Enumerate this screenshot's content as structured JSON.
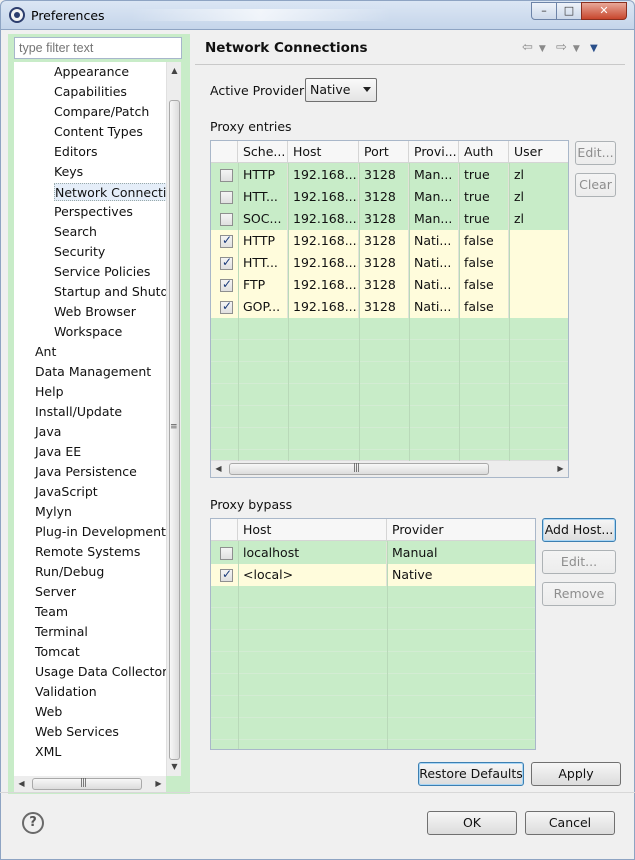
{
  "window": {
    "title": "Preferences"
  },
  "filter": {
    "placeholder": "type filter text"
  },
  "tree": {
    "items": [
      {
        "label": "Appearance",
        "level": 1
      },
      {
        "label": "Capabilities",
        "level": 1
      },
      {
        "label": "Compare/Patch",
        "level": 1
      },
      {
        "label": "Content Types",
        "level": 1
      },
      {
        "label": "Editors",
        "level": 1
      },
      {
        "label": "Keys",
        "level": 1
      },
      {
        "label": "Network Connectio",
        "level": 1,
        "selected": true
      },
      {
        "label": "Perspectives",
        "level": 1
      },
      {
        "label": "Search",
        "level": 1
      },
      {
        "label": "Security",
        "level": 1
      },
      {
        "label": "Service Policies",
        "level": 1
      },
      {
        "label": "Startup and Shutd",
        "level": 1
      },
      {
        "label": "Web Browser",
        "level": 1
      },
      {
        "label": "Workspace",
        "level": 1
      },
      {
        "label": "Ant",
        "level": 0
      },
      {
        "label": "Data Management",
        "level": 0
      },
      {
        "label": "Help",
        "level": 0
      },
      {
        "label": "Install/Update",
        "level": 0
      },
      {
        "label": "Java",
        "level": 0
      },
      {
        "label": "Java EE",
        "level": 0
      },
      {
        "label": "Java Persistence",
        "level": 0
      },
      {
        "label": "JavaScript",
        "level": 0
      },
      {
        "label": "Mylyn",
        "level": 0
      },
      {
        "label": "Plug-in Development",
        "level": 0
      },
      {
        "label": "Remote Systems",
        "level": 0
      },
      {
        "label": "Run/Debug",
        "level": 0
      },
      {
        "label": "Server",
        "level": 0
      },
      {
        "label": "Team",
        "level": 0
      },
      {
        "label": "Terminal",
        "level": 0
      },
      {
        "label": "Tomcat",
        "level": 0
      },
      {
        "label": "Usage Data Collector",
        "level": 0
      },
      {
        "label": "Validation",
        "level": 0
      },
      {
        "label": "Web",
        "level": 0
      },
      {
        "label": "Web Services",
        "level": 0
      },
      {
        "label": "XML",
        "level": 0
      }
    ]
  },
  "page": {
    "title": "Network Connections",
    "active_provider_label": "Active Provider:",
    "active_provider_value": "Native",
    "proxy_entries_label": "Proxy entries",
    "proxy_bypass_label": "Proxy bypass"
  },
  "proxy_entries": {
    "columns": [
      "Sche...",
      "Host",
      "Port",
      "Provi...",
      "Auth",
      "User"
    ],
    "rows": [
      {
        "checked": false,
        "scheme": "HTTP",
        "host": "192.168....",
        "port": "3128",
        "provider": "Man...",
        "auth": "true",
        "user": "zl",
        "style": "green"
      },
      {
        "checked": false,
        "scheme": "HTT...",
        "host": "192.168....",
        "port": "3128",
        "provider": "Man...",
        "auth": "true",
        "user": "zl",
        "style": "green"
      },
      {
        "checked": false,
        "scheme": "SOC...",
        "host": "192.168....",
        "port": "3128",
        "provider": "Man...",
        "auth": "true",
        "user": "zl",
        "style": "green"
      },
      {
        "checked": true,
        "scheme": "HTTP",
        "host": "192.168....",
        "port": "3128",
        "provider": "Nati...",
        "auth": "false",
        "user": "",
        "style": "yellow"
      },
      {
        "checked": true,
        "scheme": "HTT...",
        "host": "192.168....",
        "port": "3128",
        "provider": "Nati...",
        "auth": "false",
        "user": "",
        "style": "yellow"
      },
      {
        "checked": true,
        "scheme": "FTP",
        "host": "192.168....",
        "port": "3128",
        "provider": "Nati...",
        "auth": "false",
        "user": "",
        "style": "yellow"
      },
      {
        "checked": true,
        "scheme": "GOP...",
        "host": "192.168....",
        "port": "3128",
        "provider": "Nati...",
        "auth": "false",
        "user": "",
        "style": "yellow"
      }
    ],
    "edit_label": "Edit...",
    "clear_label": "Clear"
  },
  "proxy_bypass": {
    "columns": [
      "Host",
      "Provider"
    ],
    "rows": [
      {
        "checked": false,
        "host": "localhost",
        "provider": "Manual",
        "style": "green"
      },
      {
        "checked": true,
        "host": "<local>",
        "provider": "Native",
        "style": "yellow"
      }
    ],
    "add_host_label": "Add Host...",
    "edit_label": "Edit...",
    "remove_label": "Remove"
  },
  "buttons": {
    "restore_defaults": "Restore Defaults",
    "apply": "Apply",
    "ok": "OK",
    "cancel": "Cancel",
    "help_glyph": "?"
  },
  "colors": {
    "pane_green": "#c8ecc8",
    "row_yellow": "#fffcdc"
  }
}
